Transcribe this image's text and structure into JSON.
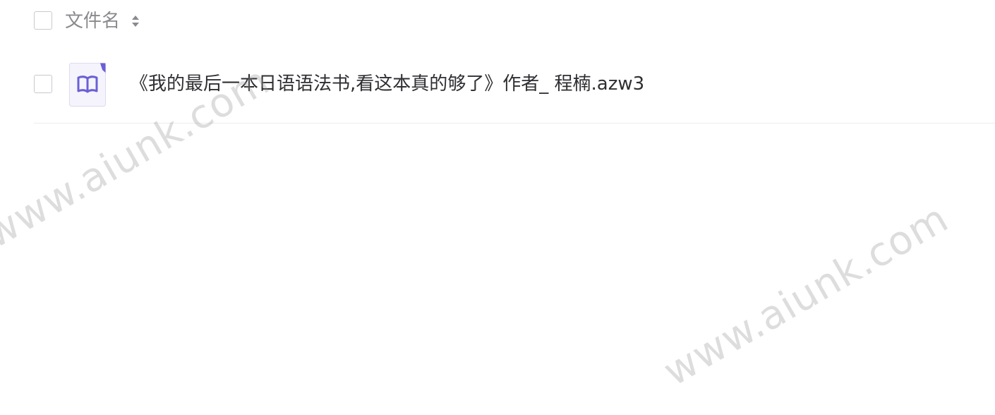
{
  "table": {
    "header": {
      "column_title": "文件名"
    },
    "rows": [
      {
        "file_name": "《我的最后一本日语语法书,看这本真的够了》作者_ 程楠.azw3",
        "file_type_icon": "ebook-icon"
      }
    ]
  },
  "watermarks": [
    "www.aiunk.com",
    "www.aiunk.com"
  ],
  "colors": {
    "icon_accent": "#6b5fd6",
    "icon_background": "#f5f4fc",
    "text_primary": "#2f2f33",
    "text_secondary": "#8a8a8e"
  }
}
